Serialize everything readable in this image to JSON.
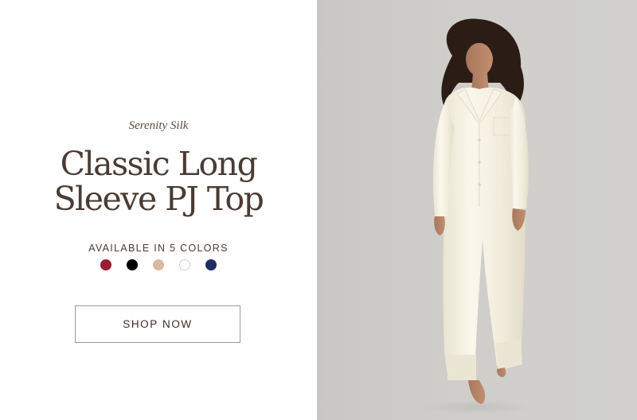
{
  "promo": {
    "eyebrow": "Serenity Silk",
    "title_line1": "Classic Long",
    "title_line2": "Sleeve PJ Top",
    "availability": "AVAILABLE IN 5 COLORS",
    "cta_label": "SHOP NOW"
  },
  "swatches": [
    {
      "name": "burgundy",
      "color": "#9b1b30"
    },
    {
      "name": "black",
      "color": "#000000"
    },
    {
      "name": "champagne",
      "color": "#d9b8a4"
    },
    {
      "name": "ivory",
      "color": "#ffffff"
    },
    {
      "name": "navy",
      "color": "#1f2f63"
    }
  ],
  "colors": {
    "title": "#4a3b33",
    "backdrop": "#cfcecb",
    "garment": "#f4f0e2"
  }
}
